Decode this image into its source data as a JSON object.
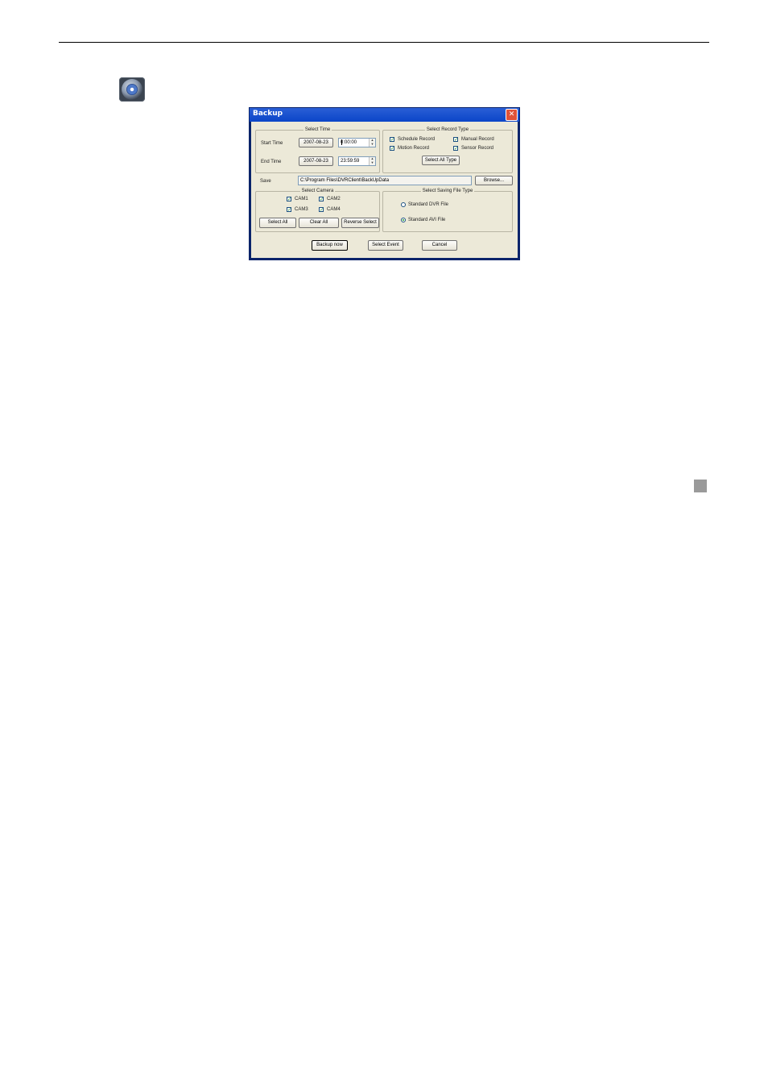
{
  "dialog": {
    "title": "Backup",
    "close_glyph": "✕",
    "select_time": {
      "legend": "Select Time",
      "start_label": "Start Time",
      "start_date": "2007-08-23",
      "start_time": "0:00:00",
      "end_label": "End Time",
      "end_date": "2007-08-23",
      "end_time": "23:59:59"
    },
    "record_type": {
      "legend": "Select Record Type",
      "schedule": "Schedule Record",
      "manual": "Manual Record",
      "motion": "Motion Record",
      "sensor": "Sensor Record",
      "select_all_type": "Select All Type"
    },
    "save": {
      "label": "Save",
      "path": "C:\\Program Files\\DVRClient\\BackUpData",
      "browse": "Browse..."
    },
    "camera": {
      "legend": "Select Camera",
      "cams": [
        "CAM1",
        "CAM2",
        "CAM3",
        "CAM4"
      ],
      "select_all": "Select All",
      "clear_all": "Clear All",
      "reverse_select": "Reverse Select"
    },
    "file_type": {
      "legend": "Select Saving File Type",
      "dvr": "Standard DVR File",
      "avi": "Standard AVI File",
      "selected": "Standard AVI File"
    },
    "buttons": {
      "backup_now": "Backup now",
      "select_event": "Select Event",
      "cancel": "Cancel"
    },
    "check_glyph": "✓",
    "spin_up": "▲",
    "spin_down": "▼"
  }
}
